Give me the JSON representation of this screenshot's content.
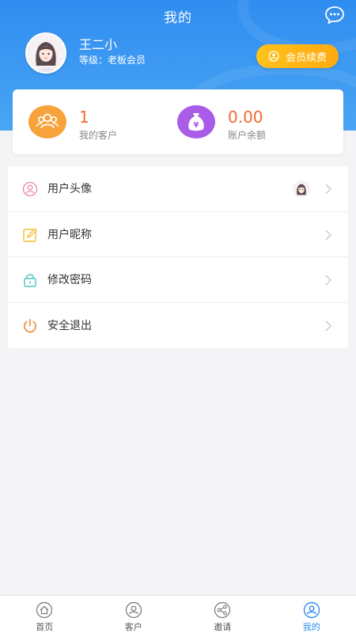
{
  "header": {
    "title": "我的",
    "chat_icon": "chat-bubble-icon"
  },
  "user": {
    "name": "王二小",
    "level": "等级：老板会员",
    "renew_label": "会员续费"
  },
  "stats": {
    "customers": {
      "value": "1",
      "label": "我的客户",
      "color": "#f7a23a"
    },
    "balance": {
      "value": "0.00",
      "label": "账户余额",
      "color": "#a85ce8"
    }
  },
  "menu": {
    "items": [
      {
        "label": "用户头像",
        "icon": "user-circle-icon"
      },
      {
        "label": "用户昵称",
        "icon": "edit-icon"
      },
      {
        "label": "修改密码",
        "icon": "lock-icon"
      },
      {
        "label": "安全退出",
        "icon": "power-icon"
      }
    ]
  },
  "tabbar": {
    "items": [
      {
        "label": "首页",
        "icon": "home-icon"
      },
      {
        "label": "客户",
        "icon": "customer-icon"
      },
      {
        "label": "邀请",
        "icon": "share-icon"
      },
      {
        "label": "我的",
        "icon": "profile-icon"
      }
    ],
    "active_index": 3
  },
  "colors": {
    "primary": "#2f8df0",
    "accent_orange": "#f06a2d",
    "renew_gold": "#ffb414"
  }
}
